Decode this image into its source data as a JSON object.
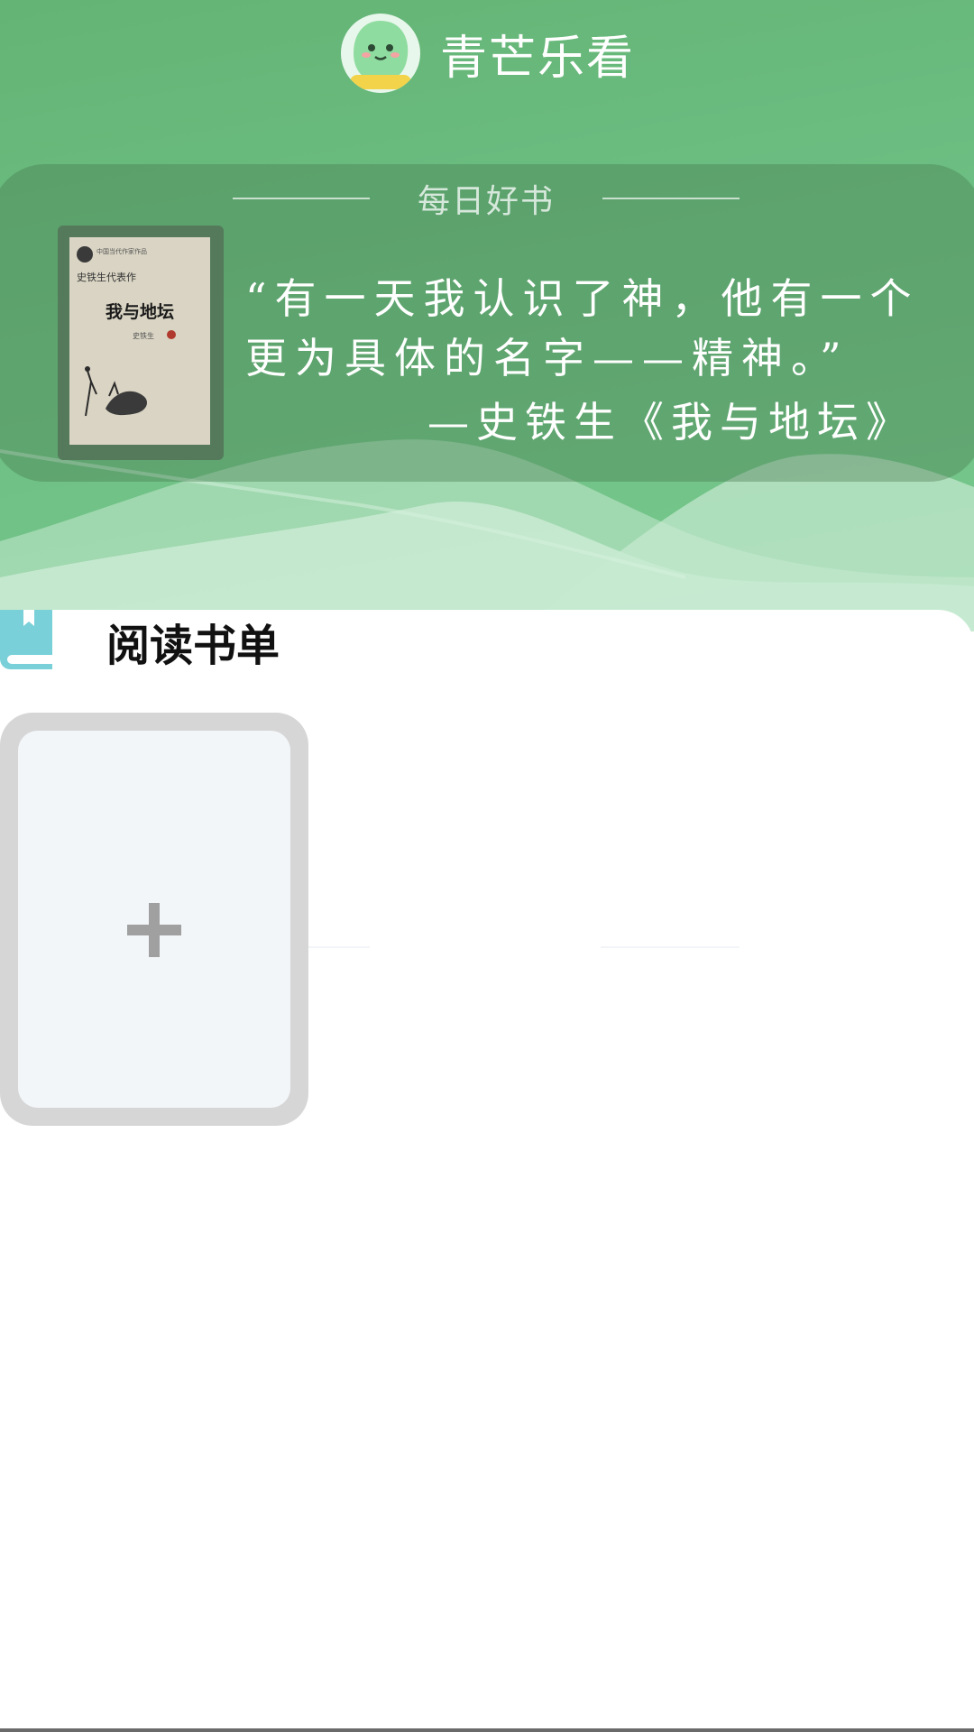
{
  "app": {
    "title": "青芒乐看",
    "logo_text": "青芒乐看"
  },
  "daily_book": {
    "heading": "每日好书",
    "cover": {
      "series": "中国当代作家作品",
      "author_line": "史铁生代表作",
      "title": "我与地坛",
      "author": "史铁生"
    },
    "quote_lines": [
      "“有一天我认识了神，他有一个",
      "更为具体的名字——精神。”"
    ],
    "attribution": "—史铁生《我与地坛》"
  },
  "reading_list": {
    "title": "阅读书单",
    "add_symbol": "+"
  },
  "colors": {
    "header_green": "#6cbe82",
    "icon_teal": "#7ad0d8",
    "add_card_border": "#d6d6d6",
    "add_card_fill": "#f3f6f9"
  },
  "icons": {
    "logo": "mango-face-icon",
    "section": "book-icon",
    "add": "plus-icon"
  }
}
